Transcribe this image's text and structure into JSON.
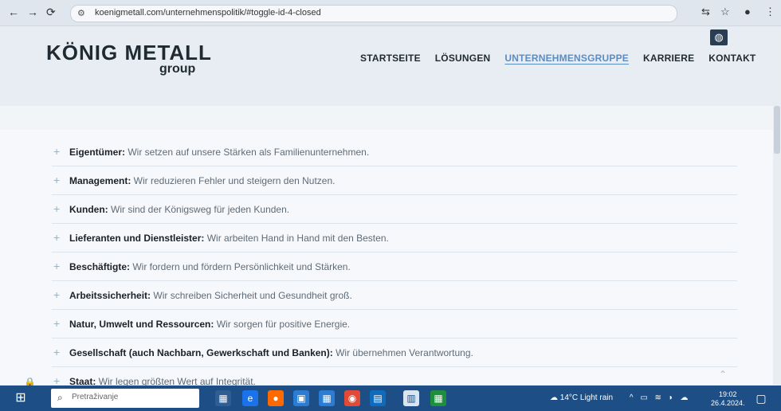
{
  "browser": {
    "url": "koenigmetall.com/unternehmenspolitik/#toggle-id-4-closed"
  },
  "logo": {
    "line1": "KÖNIG METALL",
    "line2": "group"
  },
  "nav": {
    "items": [
      "STARTSEITE",
      "LÖSUNGEN",
      "UNTERNEHMENSGRUPPE",
      "KARRIERE",
      "KONTAKT"
    ],
    "active": "UNTERNEHMENSGRUPPE"
  },
  "list": [
    {
      "title": "Eigentümer:",
      "text": " Wir setzen auf unsere Stärken als Familienunternehmen."
    },
    {
      "title": "Management:",
      "text": " Wir reduzieren Fehler und steigern den Nutzen."
    },
    {
      "title": "Kunden:",
      "text": " Wir sind der Königsweg für jeden Kunden."
    },
    {
      "title": "Lieferanten und Dienstleister:",
      "text": " Wir arbeiten Hand in Hand mit den Besten."
    },
    {
      "title": "Beschäftigte:",
      "text": " Wir fordern und fördern Persönlichkeit und Stärken."
    },
    {
      "title": "Arbeitssicherheit:",
      "text": " Wir schreiben Sicherheit und Gesundheit groß."
    },
    {
      "title": "Natur, Umwelt und Ressourcen:",
      "text": " Wir sorgen für positive Energie."
    },
    {
      "title": "Gesellschaft (auch Nachbarn, Gewerkschaft und Banken):",
      "text": " Wir übernehmen Verantwortung."
    },
    {
      "title": "Staat:",
      "text": " Wir legen größten Wert auf Integrität."
    }
  ],
  "taskbar": {
    "search_placeholder": "Pretraživanje",
    "weather": "14°C Light rain",
    "time": "19:02",
    "date": "26.4.2024."
  },
  "colors": {
    "active_nav": "#5b8cc4",
    "taskbar": "#1d4f86"
  }
}
